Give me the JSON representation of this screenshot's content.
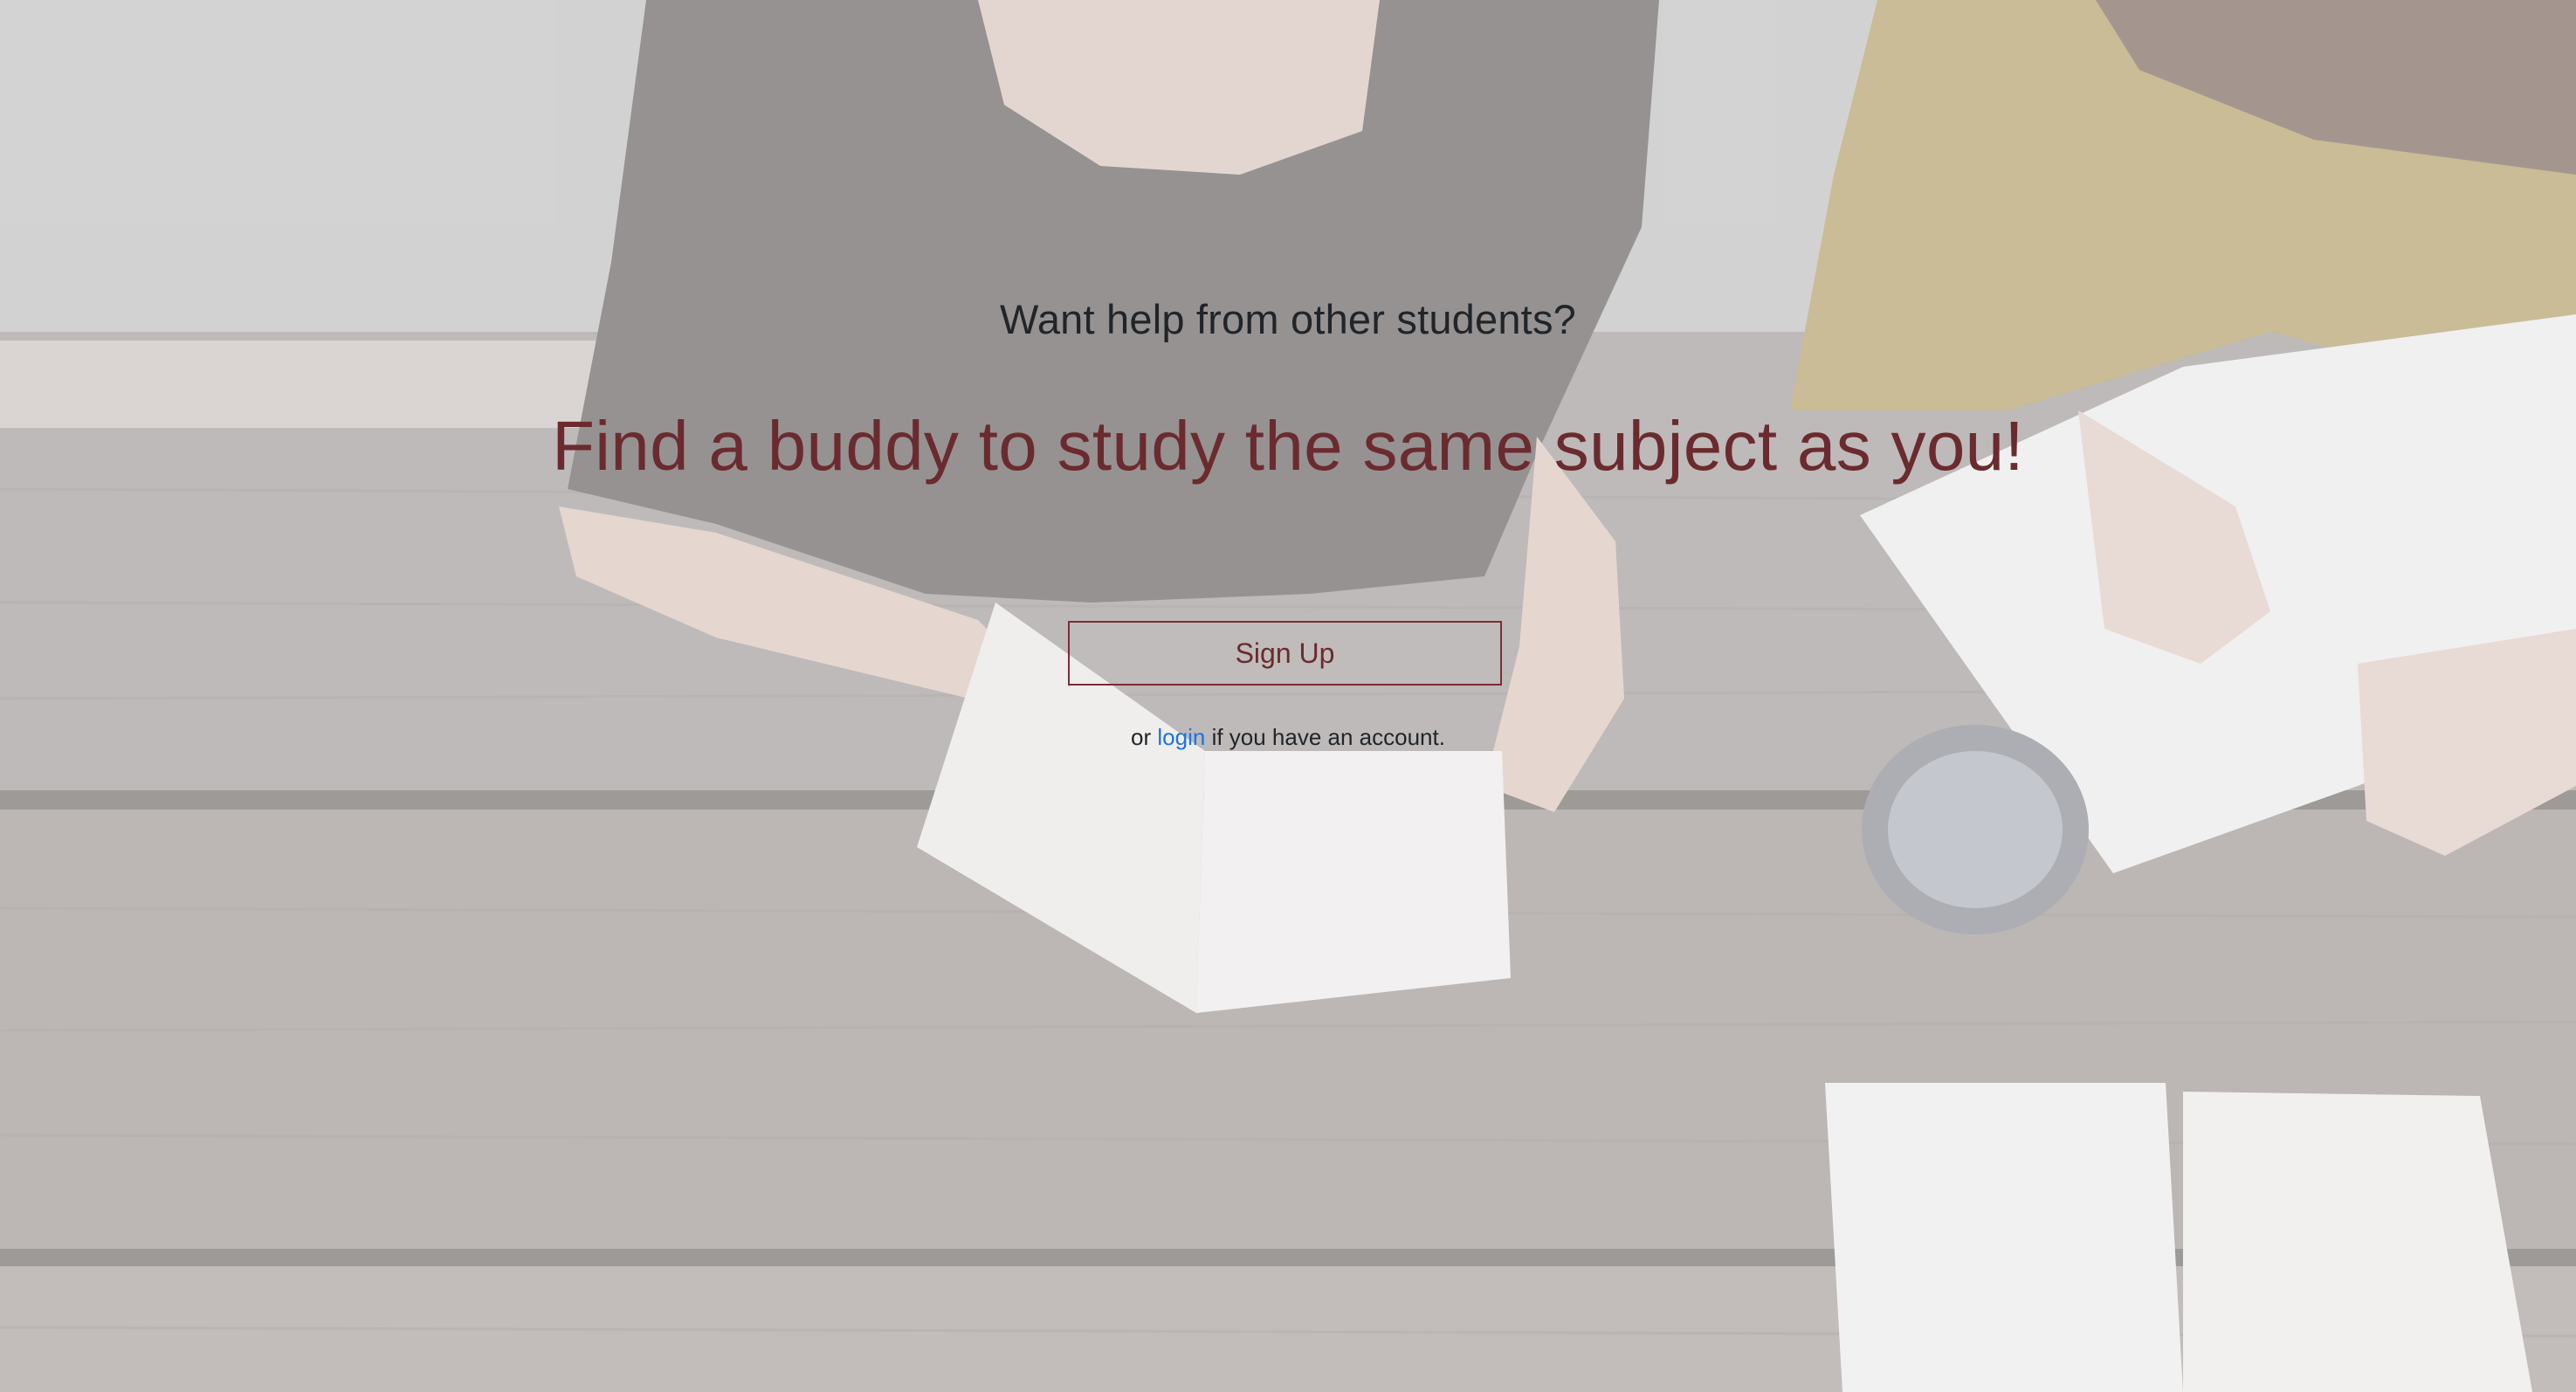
{
  "hero": {
    "subtitle": "Want help from other students?",
    "headline": "Find a buddy to study the same subject as you!",
    "signup_label": "Sign Up",
    "login_prefix": "or",
    "login_link": "login",
    "login_suffix": "if you have an account."
  },
  "colors": {
    "headline": "#6b2b2e",
    "button_border": "#7a2e33",
    "link": "#1a73e8",
    "text": "#212529"
  }
}
